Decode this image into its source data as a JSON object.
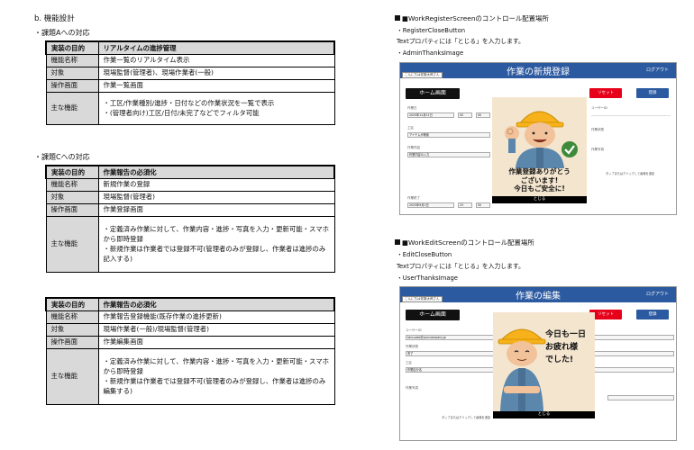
{
  "section_title": "b. 機能設計",
  "task_a": {
    "heading": "・課題Aへの対応",
    "rows": [
      {
        "label": "実装の目的",
        "value": "リアルタイムの進捗管理"
      },
      {
        "label": "機能名称",
        "value": "作業一覧のリアルタイム表示"
      },
      {
        "label": "対象",
        "value": "現場監督(管理者)、現場作業者(一般)"
      },
      {
        "label": "操作画面",
        "value": "作業一覧画面"
      }
    ],
    "main_label": "主な機能",
    "main_items": [
      "・工区/作業種別/進捗・日付などの作業状況を一覧で表示",
      "・(管理者向け)工区/日付/未完了などでフィルタ可能"
    ]
  },
  "task_c": {
    "heading": "・課題Cへの対応",
    "rows": [
      {
        "label": "実装の目的",
        "value": "作業報告の必須化"
      },
      {
        "label": "機能名称",
        "value": "新規作業の登録"
      },
      {
        "label": "対象",
        "value": "現場監督(管理者)"
      },
      {
        "label": "操作画面",
        "value": "作業登録画面"
      }
    ],
    "main_label": "主な機能",
    "main_items": [
      "・定義済み作業に対して、作業内容・進捗・写真を入力・更新可能・スマホから即時登録",
      "・新規作業は作業者では登録不可(管理者のみが登録し、作業者は進捗のみ記入する)"
    ]
  },
  "task_c2": {
    "rows": [
      {
        "label": "実装の目的",
        "value": "作業報告の必須化"
      },
      {
        "label": "機能名称",
        "value": "作業報告登録機能(既存作業の進捗更新)"
      },
      {
        "label": "対象",
        "value": "現場作業者(一般)/現場監督(管理者)"
      },
      {
        "label": "操作画面",
        "value": "作業編集画面"
      }
    ],
    "main_label": "主な機能",
    "main_items": [
      "・定義済み作業に対して、作業内容・進捗・写真を入力・更新可能・スマホから即時登録",
      "・新規作業は作業者では登録不可(管理者のみが登録し、作業者は進捗のみ編集する)"
    ]
  },
  "register": {
    "title": "■WorkRegisterScreenのコントロール配置場所",
    "line1": "・RegisterCloseButton",
    "line2": "Textプロパティには「とじる」を入力します。",
    "line3": "・AdminThanksImage",
    "mock": {
      "app_title": "作業の新規登録",
      "logout": "ログアウト",
      "user_tab": "こんにちは佐藤太郎さん",
      "home": "ホーム画面",
      "reset": "リセット",
      "register": "登録",
      "popup_message": "作業登録ありがとう\nございます!\n今日もご安全に!",
      "close": "とじる",
      "field_user_id": "ユーザーID",
      "field_date": "作業日",
      "field_date_value": "2025年12月21日",
      "field_hour": "00",
      "field_min": "00",
      "field_zone": "工区",
      "field_zone_value": "アイテムが検索",
      "field_status": "作業状態",
      "field_photo": "作業写真",
      "field_detail": "作業内容",
      "field_detail_value": "作業内容の入力",
      "field_end": "作業終了",
      "field_end_value": "2025年9月1日",
      "field_end_hour": "23",
      "field_end_min": "00",
      "tap_note": "タップまたはクリックして画像を追加"
    }
  },
  "edit": {
    "title": "■WorkEditScreenのコントロール配置場所",
    "line1": "・EditCloseButton",
    "line2": "Textプロパティには「とじる」を入力します。",
    "line3": "・UserThanksImage",
    "mock": {
      "app_title": "作業の編集",
      "logout": "ログアウト",
      "user_tab": "こんにちは佐藤太郎さん",
      "home": "ホーム画面",
      "reset": "リセット",
      "register": "登録",
      "popup_message": "今日も一日\nお疲れ様\nでした!",
      "close": "とじる",
      "field_user_id": "ユーザーID",
      "field_user_value": "taro.sato@yourcompany.jp",
      "field_status": "作業状態",
      "field_status_value": "完了",
      "field_zone": "工区",
      "field_zone_value": "作業区分名",
      "field_photo": "作業写真",
      "tap_note": "タップまたはクリックして画像を追加"
    }
  },
  "colors": {
    "header_blue": "#2c5aa0",
    "reset_red": "#e6001a",
    "popup_bg": "#f4e5cf",
    "table_header_gray": "#d9d9d9"
  }
}
